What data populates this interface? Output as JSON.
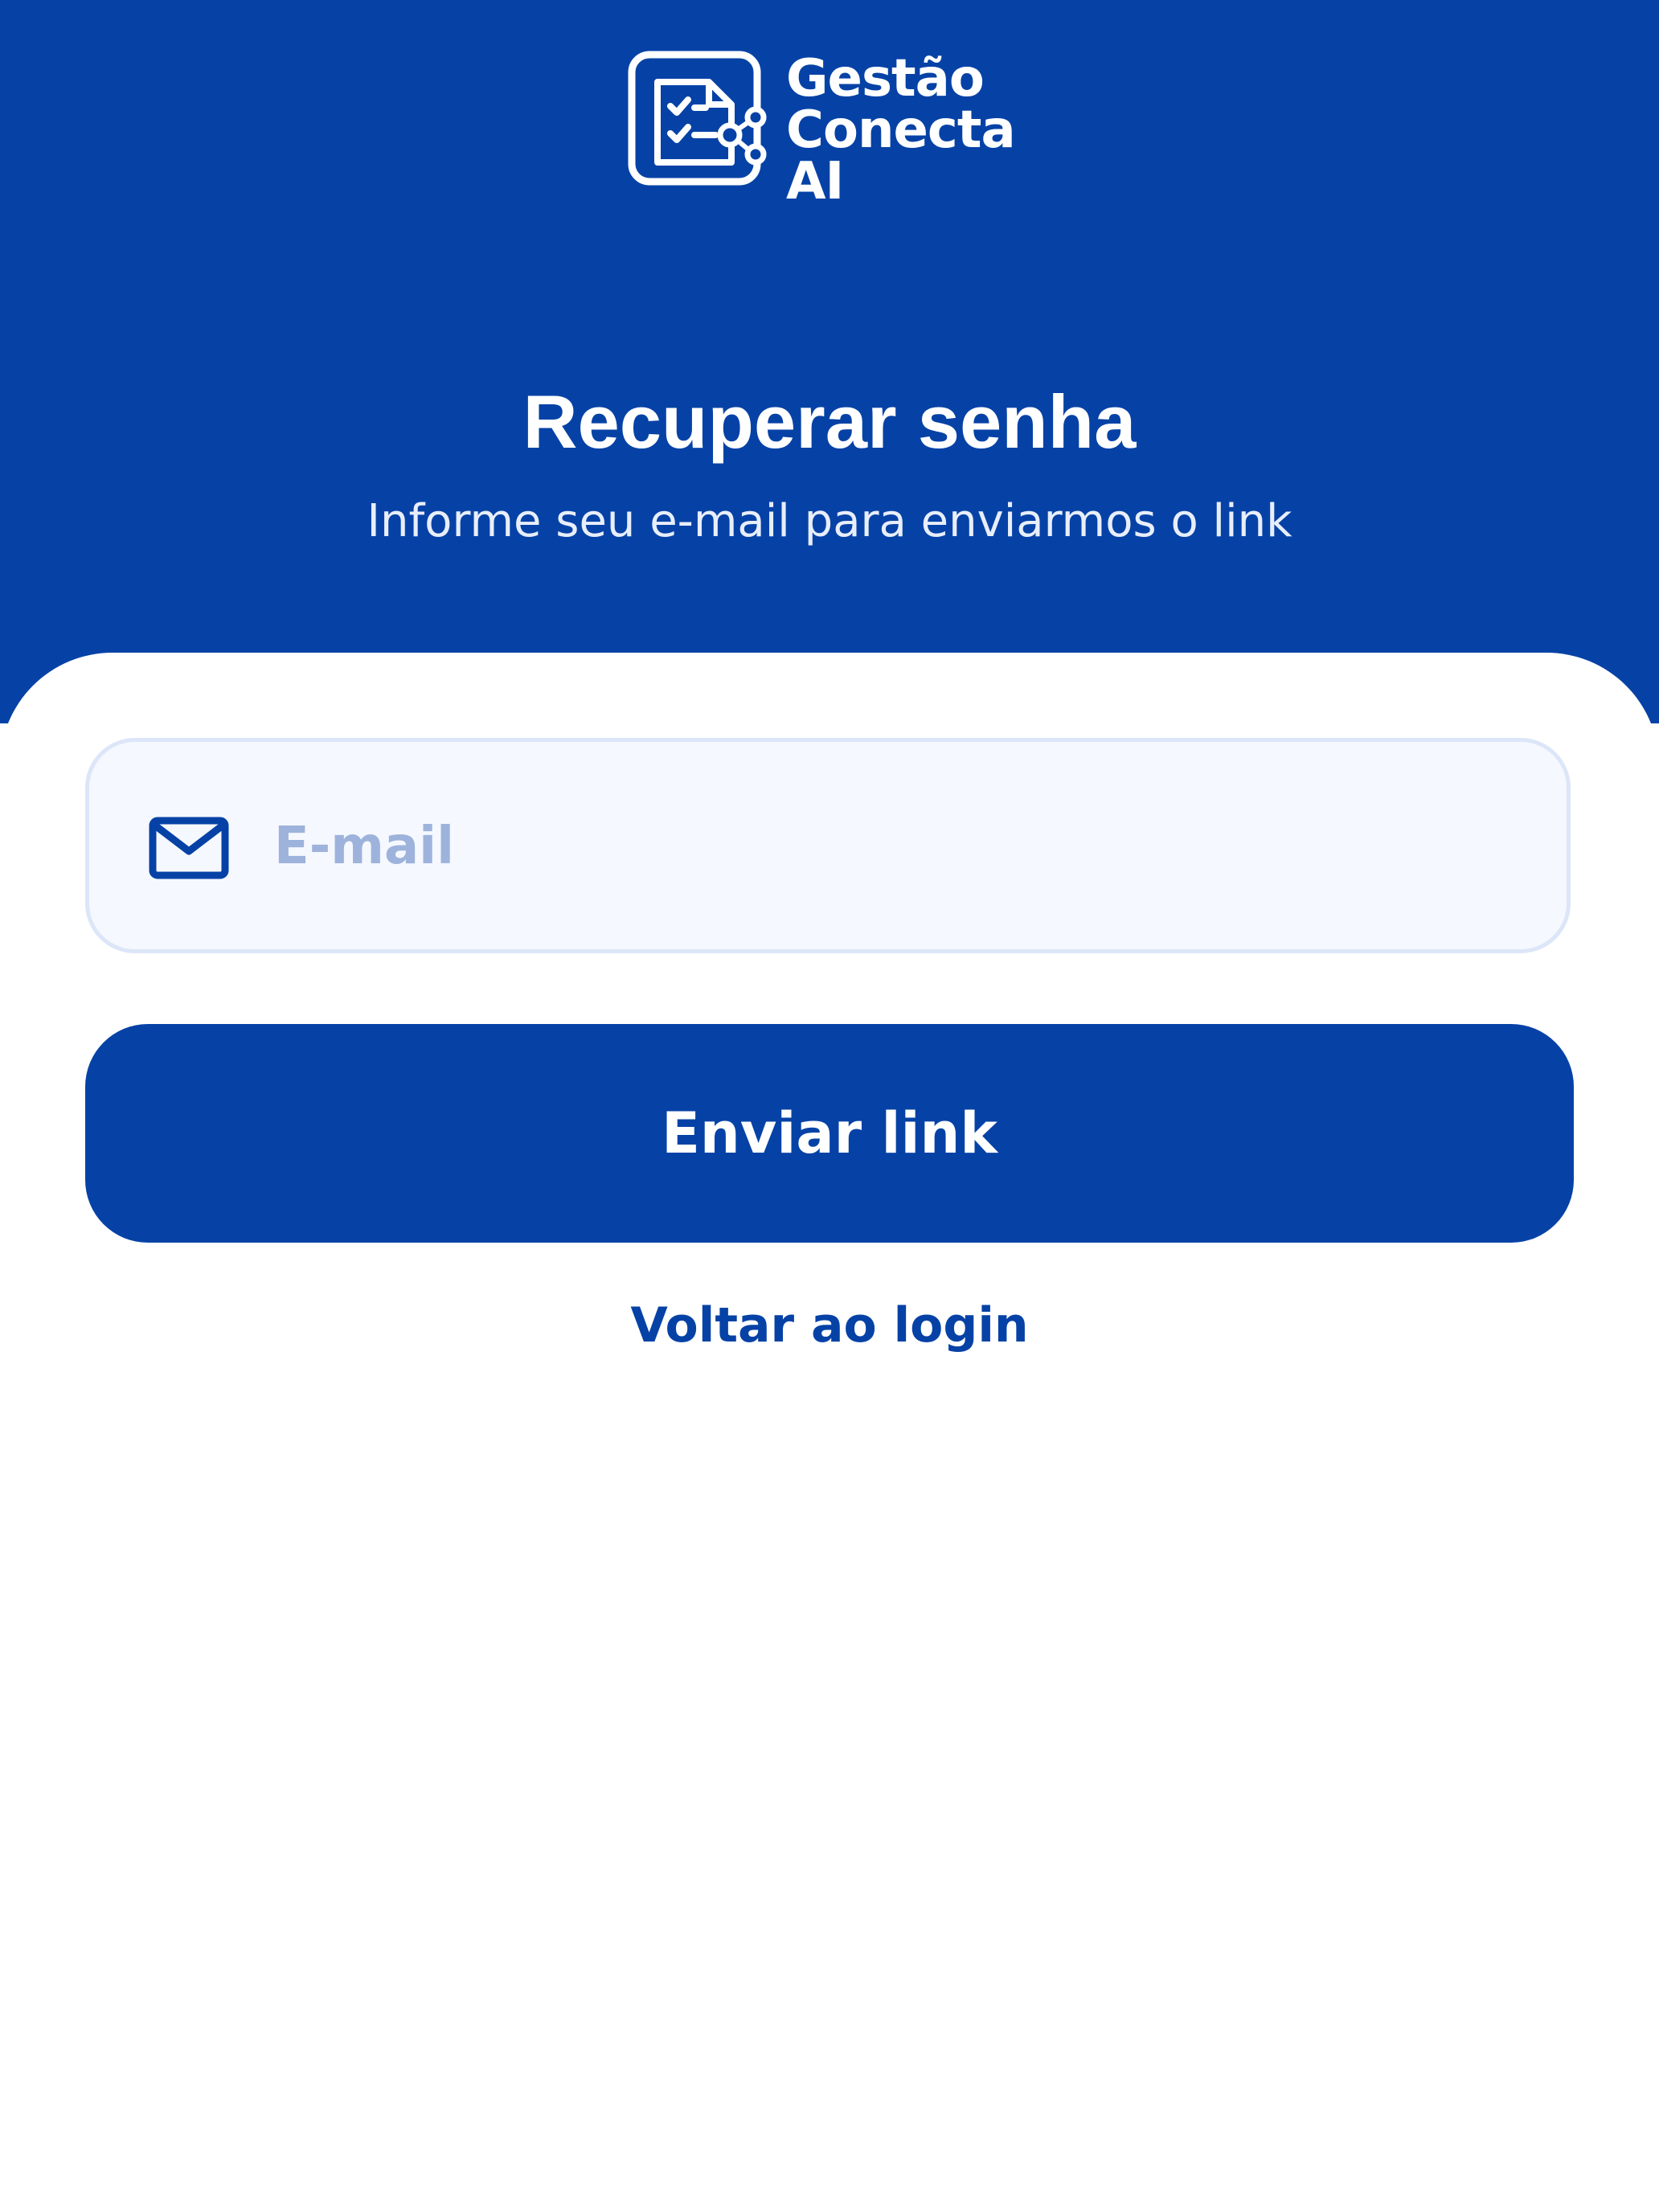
{
  "brand": {
    "logo_line1": "Gestão",
    "logo_line2": "Conecta",
    "logo_line3": "AI",
    "logo_icon": "checklist-share-icon",
    "color_primary": "#0642A6"
  },
  "header": {
    "title": "Recuperar senha",
    "subtitle": "Informe seu e-mail para enviarmos o link"
  },
  "form": {
    "email": {
      "icon": "mail-icon",
      "placeholder": "E-mail",
      "value": ""
    },
    "submit_label": "Enviar link",
    "back_label": "Voltar ao login"
  }
}
